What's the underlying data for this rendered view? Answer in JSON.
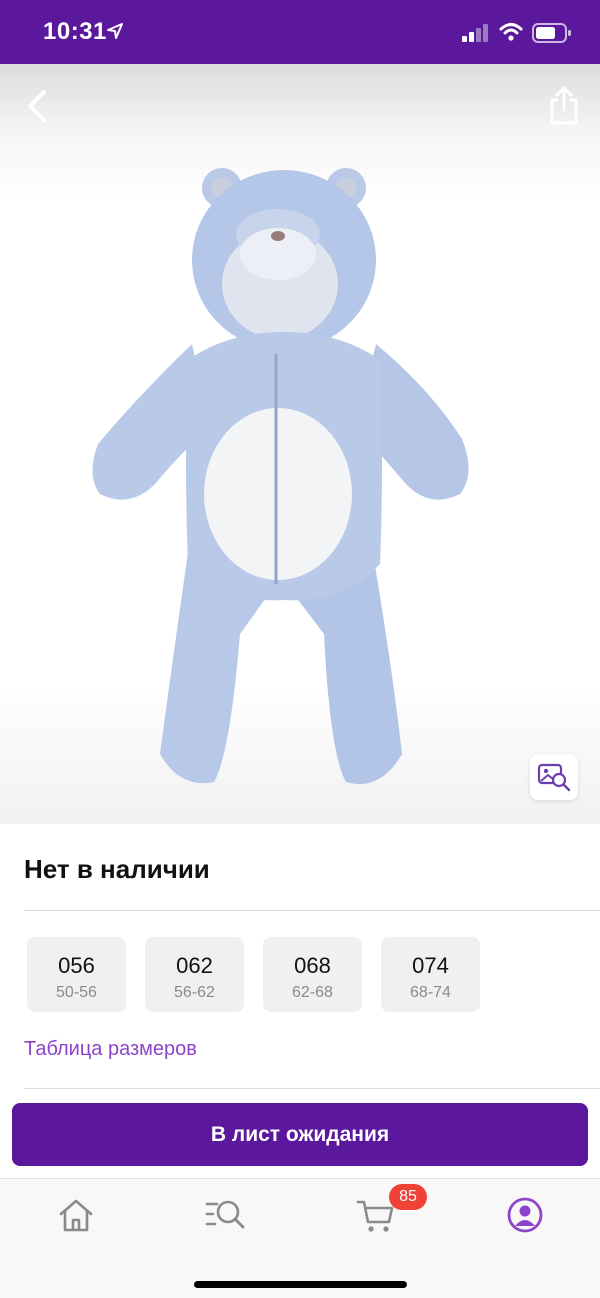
{
  "status_bar": {
    "time": "10:31",
    "icons": [
      "location-arrow-icon",
      "cellular-signal-icon",
      "wifi-icon",
      "battery-icon"
    ],
    "background": "#5b189c"
  },
  "product": {
    "image_alt": "Комбинезон",
    "stock_status": "Нет в наличии",
    "sizes": [
      {
        "code": "056",
        "range": "50-56"
      },
      {
        "code": "062",
        "range": "56-62"
      },
      {
        "code": "068",
        "range": "62-68"
      },
      {
        "code": "074",
        "range": "68-74"
      }
    ],
    "size_table_link": "Таблица размеров"
  },
  "actions": {
    "wait_list_button": "В лист ожидания"
  },
  "tabbar": {
    "items": [
      "home-icon",
      "catalog-search-icon",
      "cart-icon",
      "profile-icon"
    ],
    "active": "profile-icon",
    "cart_count": "85"
  },
  "colors": {
    "brand": "#5b189c",
    "link": "#8d44c9",
    "badge": "#ef4135",
    "tab_icon": "#8a8a8a",
    "tab_icon_active": "#8d44c9"
  }
}
